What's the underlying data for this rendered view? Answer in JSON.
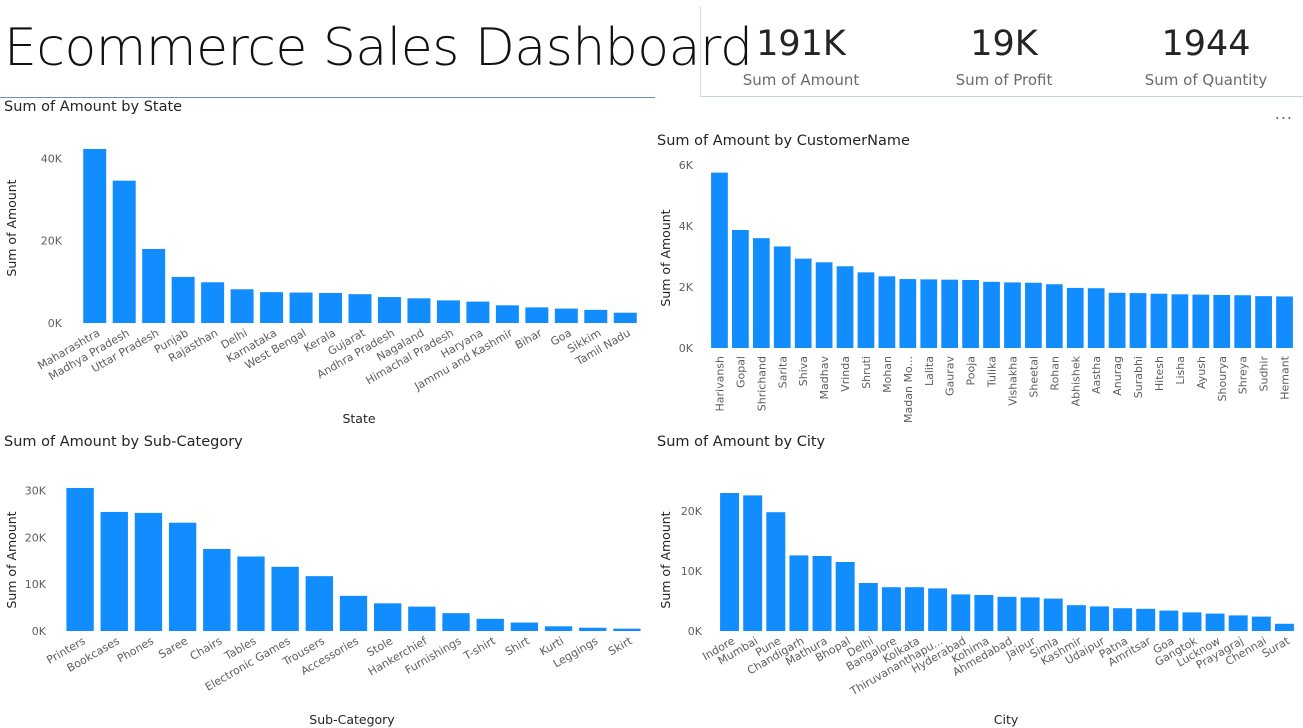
{
  "header": {
    "title": "Ecommerce Sales Dashboard"
  },
  "kpis": [
    {
      "value": "191K",
      "label": "Sum of Amount"
    },
    {
      "value": "19K",
      "label": "Sum of Profit"
    },
    {
      "value": "1944",
      "label": "Sum of Quantity"
    }
  ],
  "more_options": "...",
  "colors": {
    "bar": "#118DFF"
  },
  "chart_data": [
    {
      "type": "bar",
      "title": "Sum of Amount by State",
      "xlabel": "State",
      "ylabel": "Sum of Amount",
      "ylim": [
        0,
        44000
      ],
      "yticks": [
        0,
        20000,
        40000
      ],
      "ytick_labels": [
        "0K",
        "20K",
        "40K"
      ],
      "categories": [
        "Maharashtra",
        "Madhya Pradesh",
        "Uttar Pradesh",
        "Punjab",
        "Rajasthan",
        "Delhi",
        "Karnataka",
        "West Bengal",
        "Kerala",
        "Gujarat",
        "Andhra Pradesh",
        "Nagaland",
        "Himachal Pradesh",
        "Haryana",
        "Jammu and Kashmir",
        "Bihar",
        "Goa",
        "Sikkim",
        "Tamil Nadu"
      ],
      "values": [
        42300,
        34600,
        18000,
        11200,
        9900,
        8200,
        7500,
        7400,
        7300,
        7000,
        6300,
        6000,
        5500,
        5200,
        4300,
        3800,
        3500,
        3200,
        2500
      ]
    },
    {
      "type": "bar",
      "title": "Sum of Amount by CustomerName",
      "xlabel": "",
      "ylabel": "Sum of Amount",
      "ylim": [
        0,
        6000
      ],
      "yticks": [
        0,
        2000,
        4000,
        6000
      ],
      "ytick_labels": [
        "0K",
        "2K",
        "4K",
        "6K"
      ],
      "categories": [
        "Harivansh",
        "Gopal",
        "Shrichand",
        "Sarita",
        "Shiva",
        "Madhav",
        "Vrinda",
        "Shruti",
        "Mohan",
        "Madan Mo...",
        "Lalita",
        "Gaurav",
        "Pooja",
        "Tulika",
        "Vishakha",
        "Sheetal",
        "Rohan",
        "Abhishek",
        "Aastha",
        "Anurag",
        "Surabhi",
        "Hitesh",
        "Lisha",
        "Ayush",
        "Shourya",
        "Shreya",
        "Sudhir",
        "Hemant"
      ],
      "values": [
        5750,
        3870,
        3600,
        3330,
        2930,
        2810,
        2680,
        2480,
        2350,
        2260,
        2250,
        2240,
        2230,
        2170,
        2150,
        2140,
        2090,
        1970,
        1960,
        1810,
        1800,
        1780,
        1760,
        1750,
        1740,
        1730,
        1700,
        1690
      ]
    },
    {
      "type": "bar",
      "title": "Sum of Amount by Sub-Category",
      "xlabel": "Sub-Category",
      "ylabel": "Sum of Amount",
      "ylim": [
        0,
        32000
      ],
      "yticks": [
        0,
        10000,
        20000,
        30000
      ],
      "ytick_labels": [
        "0K",
        "10K",
        "20K",
        "30K"
      ],
      "categories": [
        "Printers",
        "Bookcases",
        "Phones",
        "Saree",
        "Chairs",
        "Tables",
        "Electronic Games",
        "Trousers",
        "Accessories",
        "Stole",
        "Hankerchief",
        "Furnishings",
        "T-shirt",
        "Shirt",
        "Kurti",
        "Leggings",
        "Skirt"
      ],
      "values": [
        30500,
        25400,
        25200,
        23100,
        17500,
        15900,
        13700,
        11700,
        7500,
        5900,
        5200,
        3800,
        2600,
        1800,
        1000,
        700,
        500
      ]
    },
    {
      "type": "bar",
      "title": "Sum of Amount by City",
      "xlabel": "City",
      "ylabel": "Sum of Amount",
      "ylim": [
        0,
        24000
      ],
      "yticks": [
        0,
        10000,
        20000
      ],
      "ytick_labels": [
        "0K",
        "10K",
        "20K"
      ],
      "categories": [
        "Indore",
        "Mumbai",
        "Pune",
        "Chandigarh",
        "Mathura",
        "Bhopal",
        "Delhi",
        "Bangalore",
        "Kolkata",
        "Thiruvananthapu...",
        "Hyderabad",
        "Kohima",
        "Ahmedabad",
        "Jaipur",
        "Simla",
        "Kashmir",
        "Udaipur",
        "Patna",
        "Amritsar",
        "Goa",
        "Gangtok",
        "Lucknow",
        "Prayagraj",
        "Chennai",
        "Surat"
      ],
      "values": [
        23000,
        22600,
        19800,
        12600,
        12500,
        11500,
        8000,
        7300,
        7300,
        7100,
        6100,
        6000,
        5700,
        5600,
        5400,
        4300,
        4100,
        3800,
        3700,
        3400,
        3100,
        2900,
        2600,
        2400,
        1200
      ]
    }
  ]
}
